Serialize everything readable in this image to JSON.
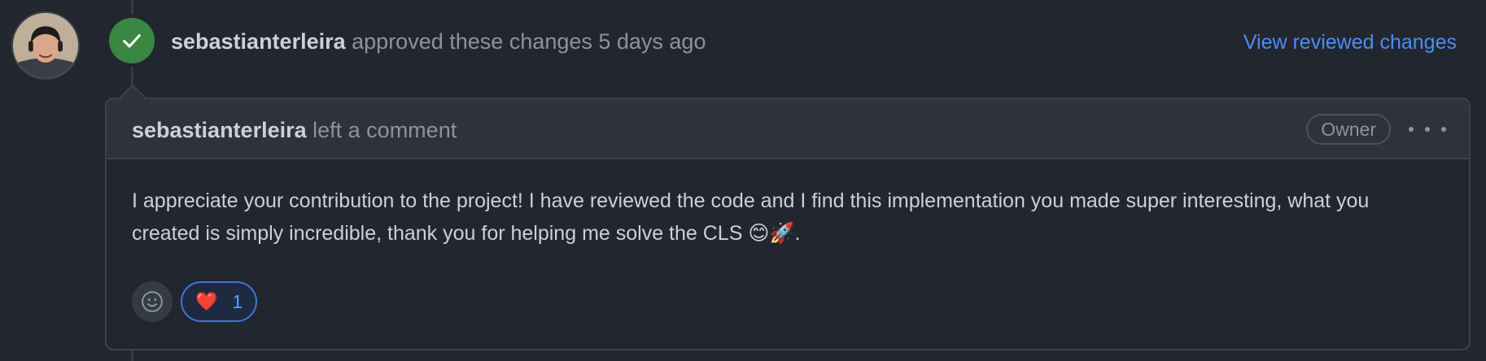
{
  "event": {
    "author": "sebastianterleira",
    "action": "approved these changes 5 days ago",
    "view_link": "View reviewed changes"
  },
  "comment": {
    "author": "sebastianterleira",
    "action": "left a comment",
    "role_badge": "Owner",
    "body": "I appreciate your contribution to the project! I have reviewed the code and I find this implementation you made super interesting, what you created is simply incredible, thank you for helping me solve the CLS 😊🚀.",
    "reactions": [
      {
        "emoji": "❤️",
        "count": "1"
      }
    ]
  },
  "colors": {
    "approved": "#3a8743",
    "link": "#4b8ef5"
  },
  "icons": {
    "approve": "check-icon",
    "add_reaction": "smiley-icon",
    "menu": "kebab-icon"
  }
}
